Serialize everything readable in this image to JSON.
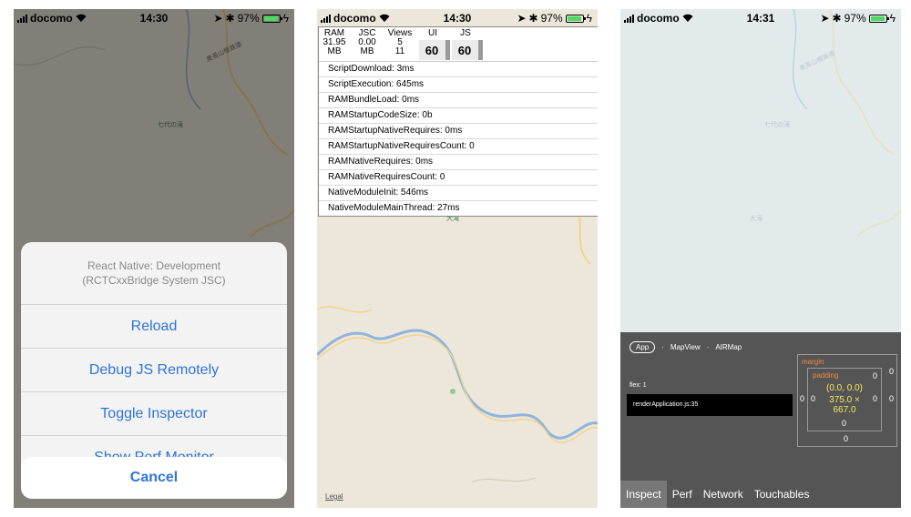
{
  "colors": {
    "ios_blue": "#2f74d8",
    "map_land": "#ece7da",
    "map_road": "#f2d48a",
    "map_water": "#8fb4de",
    "battery_green": "#4cd964",
    "inspector_bg": "#555555",
    "inspector_accent": "#f08a3e",
    "inspector_value": "#f5e85c"
  },
  "screen1": {
    "status": {
      "carrier": "docomo",
      "time": "14:30",
      "battery": "97%",
      "battery_level": 0.97
    },
    "map_labels": [
      "奥長山根鉄道",
      "七代の滝"
    ],
    "dev_menu": {
      "title": "React Native: Development (RCTCxxBridge System JSC)",
      "items": [
        "Reload",
        "Debug JS Remotely",
        "Toggle Inspector",
        "Show Perf Monitor"
      ],
      "cancel": "Cancel"
    }
  },
  "screen2": {
    "status": {
      "carrier": "docomo",
      "time": "14:30",
      "battery": "97%",
      "battery_level": 0.97
    },
    "perf_monitor": {
      "ram_label": "RAM",
      "ram_value": "31.95",
      "ram_unit": "MB",
      "jsc_label": "JSC",
      "jsc_value": "0.00",
      "jsc_unit": "MB",
      "views_label": "Views",
      "views_value": "5",
      "views_value2": "11",
      "ui_label": "UI",
      "ui_fps": "60",
      "js_label": "JS",
      "js_fps": "60",
      "rows": [
        "ScriptDownload: 3ms",
        "ScriptExecution: 645ms",
        "RAMBundleLoad: 0ms",
        "RAMStartupCodeSize: 0b",
        "RAMStartupNativeRequires: 0ms",
        "RAMStartupNativeRequiresCount: 0",
        "RAMNativeRequires: 0ms",
        "RAMNativeRequiresCount: 0",
        "NativeModuleInit: 546ms",
        "NativeModuleMainThread: 27ms"
      ]
    },
    "map_label": "大滝",
    "legal": "Legal"
  },
  "screen3": {
    "status": {
      "carrier": "docomo",
      "time": "14:31",
      "battery": "97%",
      "battery_level": 0.97
    },
    "map_labels": [
      "奥長山根鉄道",
      "七代の滝",
      "大滝"
    ],
    "inspector": {
      "breadcrumbs": [
        "App",
        "MapView",
        "AIRMap"
      ],
      "flex": "flex:  1",
      "source": "renderApplication.js:35",
      "margin_label": "margin",
      "padding_label": "padding",
      "position": "(0.0, 0.0)",
      "size_line1": "375.0 ×",
      "size_line2": "667.0",
      "zero": "0",
      "tabs": [
        "Inspect",
        "Perf",
        "Network",
        "Touchables"
      ],
      "active_tab": "Inspect"
    }
  }
}
